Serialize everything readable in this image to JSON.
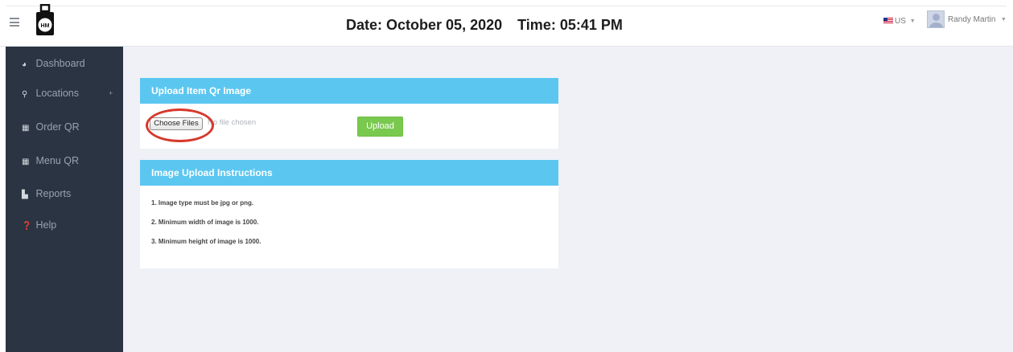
{
  "header": {
    "date_label": "Date:",
    "date_value": "October 05, 2020",
    "time_label": "Time:",
    "time_value": "05:41 PM",
    "language": "US",
    "user_name": "Randy Martin",
    "logo_text": "HM"
  },
  "sidebar": {
    "items": [
      {
        "label": "Dashboard",
        "icon": "dashboard-icon",
        "glyph": "◕"
      },
      {
        "label": "Locations",
        "icon": "map-marker-icon",
        "glyph": "⚲",
        "expand": "+"
      },
      {
        "label": "Order QR",
        "icon": "qrcode-icon",
        "glyph": "▦"
      },
      {
        "label": "Menu QR",
        "icon": "qrcode-icon",
        "glyph": "▦"
      },
      {
        "label": "Reports",
        "icon": "file-icon",
        "glyph": "▙"
      },
      {
        "label": "Help",
        "icon": "question-circle-icon",
        "glyph": "❓"
      }
    ]
  },
  "upload_panel": {
    "title": "Upload Item Qr Image",
    "choose_files_label": "Choose Files",
    "no_file_text": "No file chosen",
    "upload_label": "Upload"
  },
  "instructions_panel": {
    "title": "Image Upload Instructions",
    "items": [
      "1. Image type must be jpg or png.",
      "2. Minimum width of image is 1000.",
      "3. Minimum height of image is 1000."
    ]
  },
  "colors": {
    "sidebar_bg": "#2a3442",
    "panel_header": "#5bc7f1",
    "upload_button": "#79c94f",
    "highlight_circle": "#d7392d",
    "main_bg": "#eff1f6"
  }
}
